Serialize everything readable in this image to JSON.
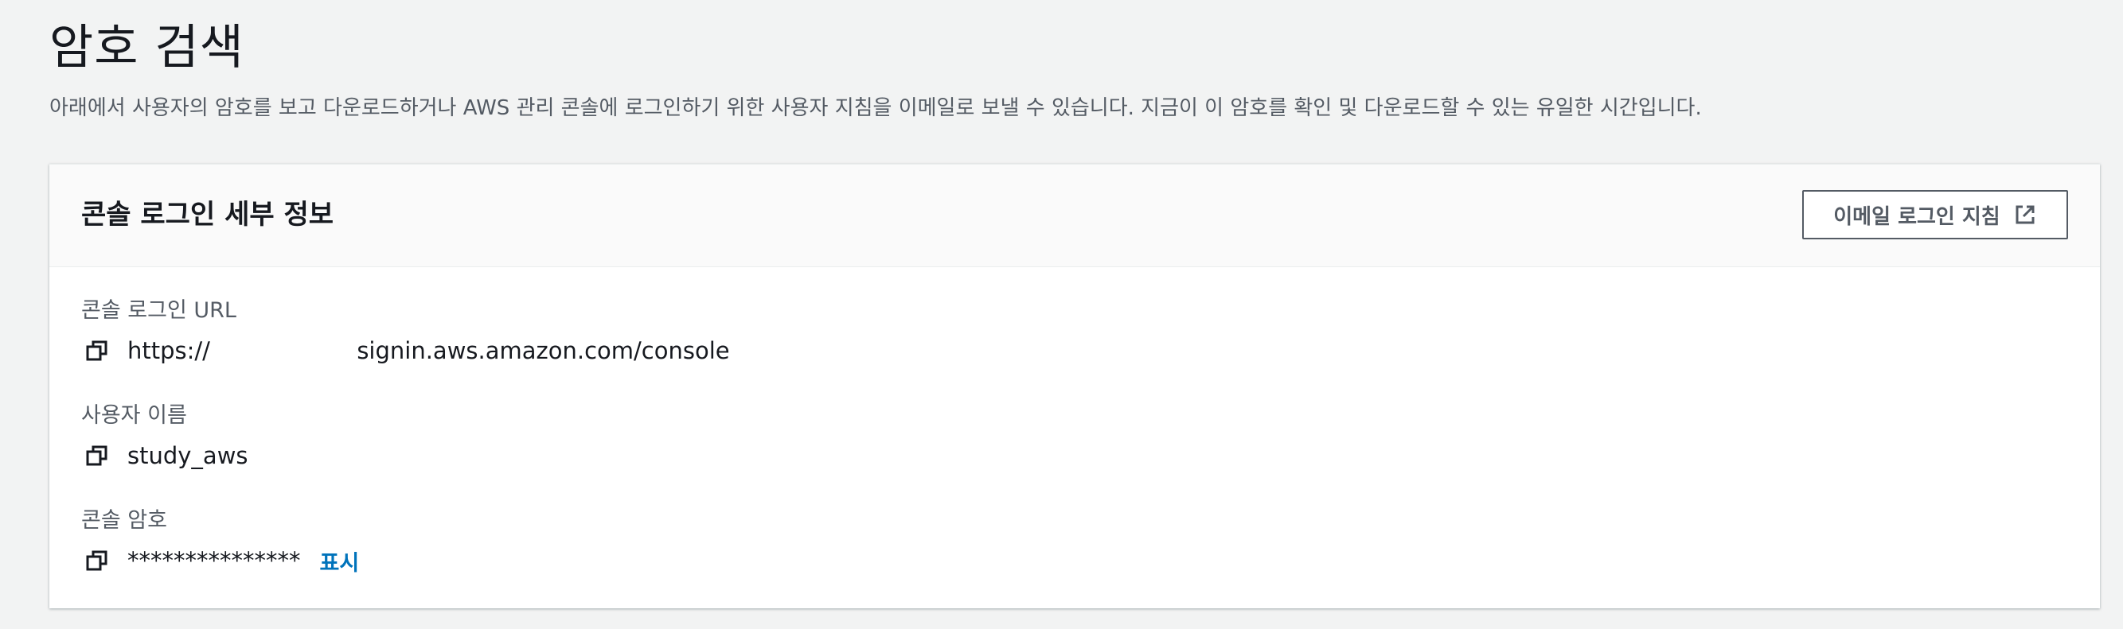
{
  "page": {
    "title": "암호 검색",
    "description": "아래에서 사용자의 암호를 보고 다운로드하거나 AWS 관리 콘솔에 로그인하기 위한 사용자 지침을 이메일로 보낼 수 있습니다. 지금이 이 암호를 확인 및 다운로드할 수 있는 유일한 시간입니다."
  },
  "panel": {
    "title": "콘솔 로그인 세부 정보",
    "email_button_label": "이메일 로그인 지침",
    "email_button_icon": "external-link-icon"
  },
  "fields": {
    "url": {
      "label": "콘솔 로그인 URL",
      "value": "https://                    signin.aws.amazon.com/console",
      "icon": "copy-icon"
    },
    "username": {
      "label": "사용자 이름",
      "value": "study_aws",
      "icon": "copy-icon"
    },
    "password": {
      "label": "콘솔 암호",
      "value": "***************",
      "show_label": "표시",
      "icon": "copy-icon"
    }
  },
  "colors": {
    "background": "#f2f3f3",
    "link": "#0073bb",
    "text": "#16191f",
    "muted": "#545b64"
  }
}
